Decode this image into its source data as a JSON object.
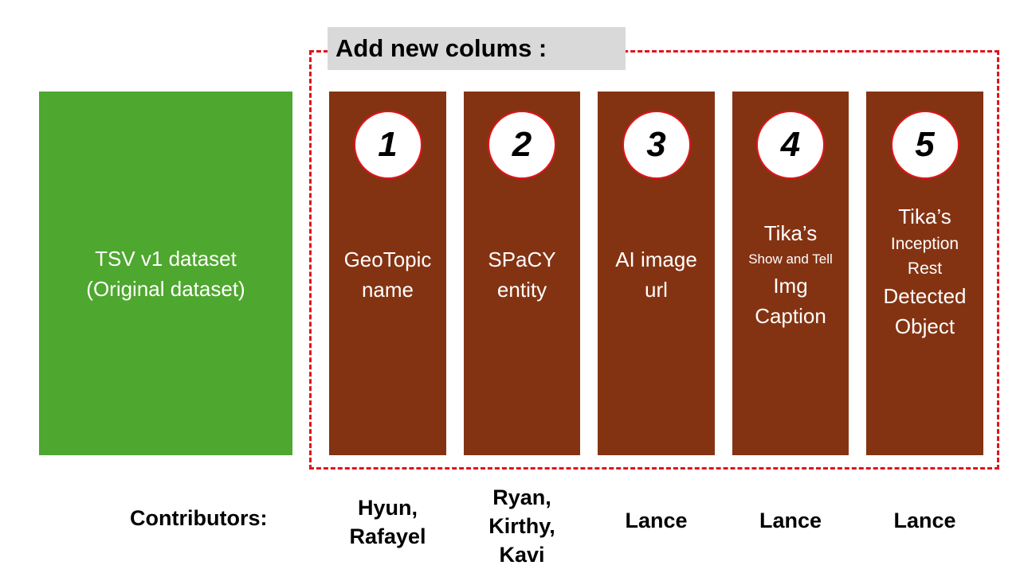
{
  "header": {
    "title": "Add new colums :"
  },
  "original": {
    "line1": "TSV v1 dataset",
    "line2": "(Original dataset)"
  },
  "columns": [
    {
      "number": "1",
      "lines": [
        "GeoTopic",
        "name"
      ],
      "contributors": [
        "Hyun,",
        "Rafayel"
      ]
    },
    {
      "number": "2",
      "lines": [
        "SPaCY",
        "entity"
      ],
      "contributors": [
        "Ryan,",
        "Kirthy,",
        "Kavi"
      ]
    },
    {
      "number": "3",
      "lines": [
        "AI image",
        "url"
      ],
      "contributors": [
        "Lance"
      ]
    },
    {
      "number": "4",
      "title": "Tika’s",
      "subtitle": "Show and Tell",
      "lines": [
        "Img",
        "Caption"
      ],
      "contributors": [
        "Lance"
      ]
    },
    {
      "number": "5",
      "title": "Tika’s",
      "subtitle": [
        "Inception",
        "Rest"
      ],
      "lines": [
        "Detected",
        "Object"
      ],
      "contributors": [
        "Lance"
      ]
    }
  ],
  "contributors_label": "Contributors:",
  "colors": {
    "original_fill": "#4ea72e",
    "column_fill": "#843312",
    "frame_dash": "#e0141b",
    "header_fill": "#d9d9d9"
  }
}
